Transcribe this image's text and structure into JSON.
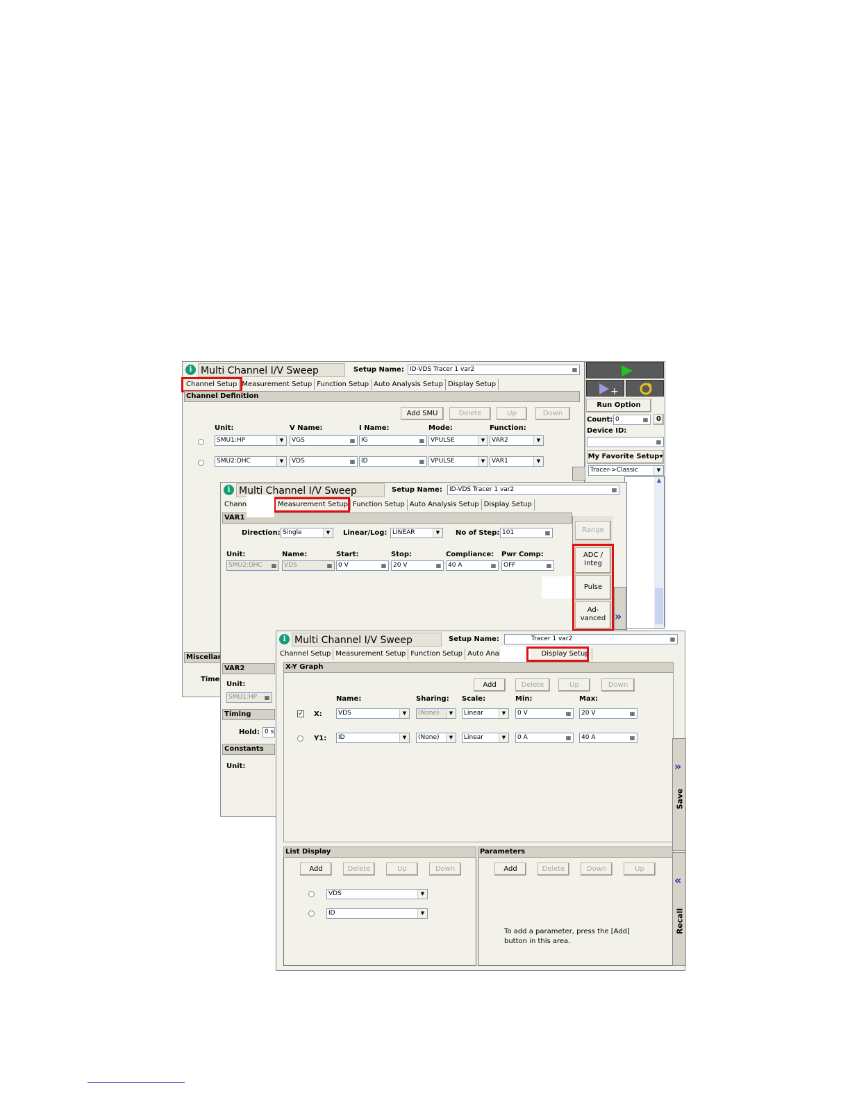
{
  "window1": {
    "title": "Multi Channel I/V Sweep",
    "setup_name_label": "Setup Name:",
    "setup_name_value": "ID-VDS Tracer 1 var2",
    "tabs": [
      "Channel Setup",
      "Measurement Setup",
      "Function Setup",
      "Auto Analysis Setup",
      "Display Setup"
    ],
    "section_title": "Channel Definition",
    "buttons": {
      "add": "Add SMU",
      "delete": "Delete",
      "up": "Up",
      "down": "Down"
    },
    "headers": {
      "unit": "Unit:",
      "vname": "V Name:",
      "iname": "I Name:",
      "mode": "Mode:",
      "function": "Function:"
    },
    "rows": [
      {
        "unit": "SMU1:HP",
        "vname": "VGS",
        "iname": "IG",
        "mode": "VPULSE",
        "function": "VAR2"
      },
      {
        "unit": "SMU2:DHC",
        "vname": "VDS",
        "iname": "ID",
        "mode": "VPULSE",
        "function": "VAR1"
      }
    ],
    "misc_label": "Miscellan",
    "time_label": "Time"
  },
  "sidepanel": {
    "run_option": "Run Option",
    "count_label": "Count:",
    "count_value": "0",
    "count_button": "0",
    "device_id_label": "Device ID:",
    "device_id_value": "",
    "favorite": "My Favorite Setup▾",
    "favorite_select": "Tracer->Classic"
  },
  "window2": {
    "title": "Multi Channel I/V Sweep",
    "setup_name_label": "Setup Name:",
    "setup_name_value": "ID-VDS Tracer 1 var2",
    "tabs": [
      "Chann",
      "Measurement Setup",
      "Function Setup",
      "Auto Analysis Setup",
      "Display Setup"
    ],
    "section": "VAR1",
    "direction_label": "Direction:",
    "direction_value": "Single",
    "linlog_label": "Linear/Log:",
    "linlog_value": "LINEAR",
    "steps_label": "No of Step:",
    "steps_value": "101",
    "headers": {
      "unit": "Unit:",
      "name": "Name:",
      "start": "Start:",
      "stop": "Stop:",
      "compliance": "Compliance:",
      "pwr": "Pwr Comp:"
    },
    "row": {
      "unit": "SMU2:DHC",
      "name": "VDS",
      "start": "0 V",
      "stop": "20 V",
      "compliance": "40 A",
      "pwr": "OFF"
    },
    "side_buttons": {
      "range": "Range",
      "adc": "ADC /\nInteg",
      "pulse": "Pulse",
      "advanced": "Ad-\nvanced"
    },
    "var2": "VAR2",
    "var2_unit_label": "Unit:",
    "var2_unit_value": "SMU1:HP",
    "timing": "Timing",
    "hold_label": "Hold:",
    "hold_value": "0 s",
    "constants": "Constants",
    "const_unit_label": "Unit:"
  },
  "window3": {
    "title": "Multi Channel I/V Sweep",
    "setup_name_label": "Setup Name:",
    "setup_name_value": "Tracer 1 var2",
    "tabs": [
      "Channel Setup",
      "Measurement Setup",
      "Function Setup",
      "Auto Analy",
      "Display Setup"
    ],
    "xy_section": "X-Y Graph",
    "buttons": {
      "add": "Add",
      "delete": "Delete",
      "up": "Up",
      "down": "Down"
    },
    "headers": {
      "name": "Name:",
      "sharing": "Sharing:",
      "scale": "Scale:",
      "min": "Min:",
      "max": "Max:"
    },
    "axes": [
      {
        "label": "X:",
        "name": "VDS",
        "sharing": "(None)",
        "scale": "Linear",
        "min": "0 V",
        "max": "20 V",
        "checked": true
      },
      {
        "label": "Y1:",
        "name": "ID",
        "sharing": "(None)",
        "scale": "Linear",
        "min": "0 A",
        "max": "40 A",
        "checked": false
      }
    ],
    "list_section": "List Display",
    "list_buttons": {
      "add": "Add",
      "delete": "Delete",
      "up": "Up",
      "down": "Down"
    },
    "list_items": [
      "VDS",
      "ID"
    ],
    "params_section": "Parameters",
    "params_buttons": {
      "add": "Add",
      "delete": "Delete",
      "down": "Down",
      "up": "Up"
    },
    "params_hint_line1": "To add a parameter, press the [Add]",
    "params_hint_line2": "button in this area.",
    "save": "Save",
    "recall": "Recall"
  },
  "colors": {
    "highlight": "#e01010",
    "run_green": "#22c422",
    "chevron": "#3131b8"
  }
}
